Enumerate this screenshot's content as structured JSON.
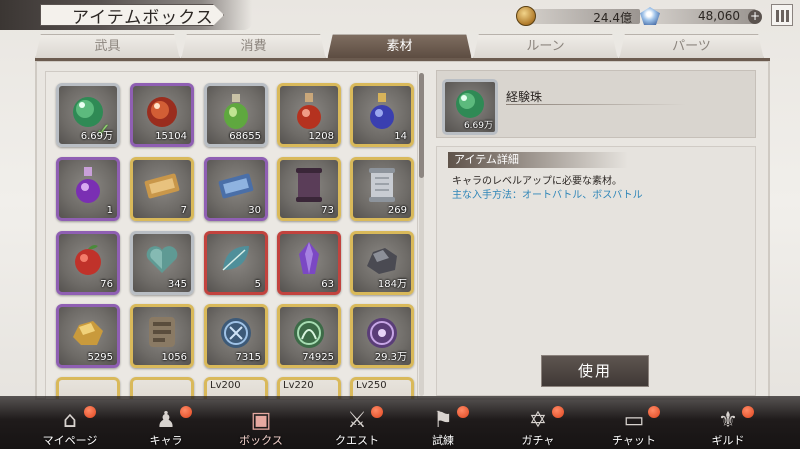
{
  "header": {
    "title": "アイテムボックス",
    "coins": "24.4億",
    "gems": "48,060"
  },
  "tabs": [
    "武具",
    "消費",
    "素材",
    "ルーン",
    "パーツ"
  ],
  "active_tab": "素材",
  "items": [
    {
      "count": "6.69万",
      "rarity": "silver",
      "art": "green-orb",
      "selected": true
    },
    {
      "count": "15104",
      "rarity": "purple",
      "art": "red-orb"
    },
    {
      "count": "68655",
      "rarity": "silver",
      "art": "green-potion"
    },
    {
      "count": "1208",
      "rarity": "gold",
      "art": "red-potion"
    },
    {
      "count": "14",
      "rarity": "gold",
      "art": "blue-potion"
    },
    {
      "count": "1",
      "rarity": "purple",
      "art": "purple-potion"
    },
    {
      "count": "7",
      "rarity": "gold",
      "art": "gold-ticket"
    },
    {
      "count": "30",
      "rarity": "purple",
      "art": "blue-ticket"
    },
    {
      "count": "73",
      "rarity": "gold",
      "art": "dark-scroll"
    },
    {
      "count": "269",
      "rarity": "gold",
      "art": "silver-scroll"
    },
    {
      "count": "76",
      "rarity": "purple",
      "art": "red-apple"
    },
    {
      "count": "345",
      "rarity": "silver",
      "art": "heart"
    },
    {
      "count": "5",
      "rarity": "red",
      "art": "leaf"
    },
    {
      "count": "63",
      "rarity": "red",
      "art": "purple-crystal"
    },
    {
      "count": "184万",
      "rarity": "gold",
      "art": "ore"
    },
    {
      "count": "5295",
      "rarity": "purple",
      "art": "gold-nugget"
    },
    {
      "count": "1056",
      "rarity": "gold",
      "art": "stone-tablet"
    },
    {
      "count": "7315",
      "rarity": "gold",
      "art": "blue-rune-coin"
    },
    {
      "count": "74925",
      "rarity": "gold",
      "art": "green-rune-coin"
    },
    {
      "count": "29.3万",
      "rarity": "gold",
      "art": "purple-rune-coin"
    }
  ],
  "partial_row": [
    {
      "level": "",
      "rarity": "gold"
    },
    {
      "level": "",
      "rarity": "gold"
    },
    {
      "level": "Lv200",
      "rarity": "gold"
    },
    {
      "level": "Lv220",
      "rarity": "gold"
    },
    {
      "level": "Lv250",
      "rarity": "gold"
    }
  ],
  "selected_item": {
    "name": "経験珠",
    "count": "6.69万"
  },
  "detail": {
    "heading": "アイテム詳細",
    "description": "キャラのレベルアップに必要な素材。",
    "source": "主な入手方法：オートバトル、ボスバトル"
  },
  "use_button": "使用",
  "nav": [
    {
      "label": "マイページ",
      "icon": "home-icon",
      "badge": true
    },
    {
      "label": "キャラ",
      "icon": "characters-icon",
      "badge": true
    },
    {
      "label": "ボックス",
      "icon": "box-icon",
      "badge": false,
      "active": true
    },
    {
      "label": "クエスト",
      "icon": "swords-icon",
      "badge": true
    },
    {
      "label": "試練",
      "icon": "flag-icon",
      "badge": true
    },
    {
      "label": "ガチャ",
      "icon": "hexagram-icon",
      "badge": true
    },
    {
      "label": "チャット",
      "icon": "chat-icon",
      "badge": true
    },
    {
      "label": "ギルド",
      "icon": "guild-icon",
      "badge": true
    }
  ],
  "colors": {
    "gold_frame": "#d9b95a",
    "purple_frame": "#8f5fb3",
    "silver_frame": "#b9bec4",
    "red_frame": "#c2433e",
    "link_blue": "#2f86b8",
    "active_tab": "#6b5b4f"
  }
}
